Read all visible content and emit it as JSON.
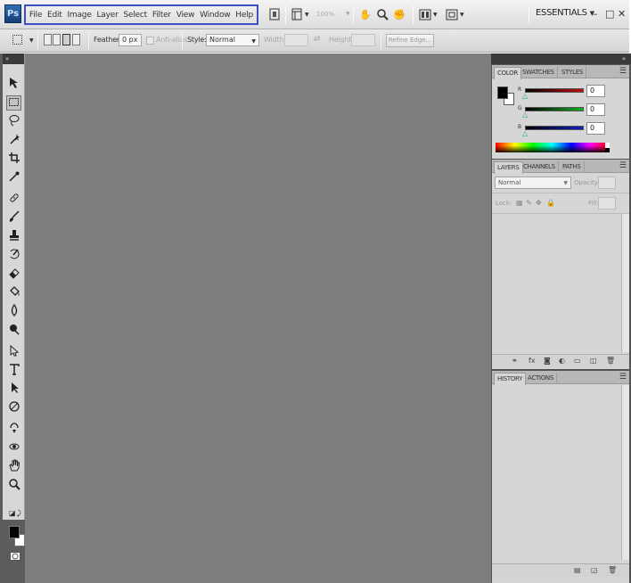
{
  "app": {
    "logo": "Ps"
  },
  "menu": [
    "File",
    "Edit",
    "Image",
    "Layer",
    "Select",
    "Filter",
    "View",
    "Window",
    "Help"
  ],
  "appbar": {
    "zoom": "100%",
    "workspace": "ESSENTIALS",
    "window_buttons": [
      "–",
      "□",
      "✕"
    ]
  },
  "options": {
    "feather_label": "Feather:",
    "feather_value": "0 px",
    "antialias_label": "Anti-alias",
    "style_label": "Style:",
    "style_value": "Normal",
    "width_label": "Width:",
    "height_label": "Height:",
    "refine_edge": "Refine Edge..."
  },
  "toolbox": {
    "collapse_label": "»"
  },
  "panels": {
    "collapse_label": "«",
    "color": {
      "tabs": [
        "COLOR",
        "SWATCHES",
        "STYLES"
      ],
      "channels": [
        {
          "letter": "R",
          "value": "0",
          "track_color": "#c01010"
        },
        {
          "letter": "G",
          "value": "0",
          "track_color": "#10b020"
        },
        {
          "letter": "B",
          "value": "0",
          "track_color": "#1020c0"
        }
      ]
    },
    "layers": {
      "tabs": [
        "LAYERS",
        "CHANNELS",
        "PATHS"
      ],
      "blend_mode": "Normal",
      "opacity_label": "Opacity:",
      "lock_label": "Lock:",
      "fill_label": "Fill:"
    },
    "history": {
      "tabs": [
        "HISTORY",
        "ACTIONS"
      ]
    }
  }
}
